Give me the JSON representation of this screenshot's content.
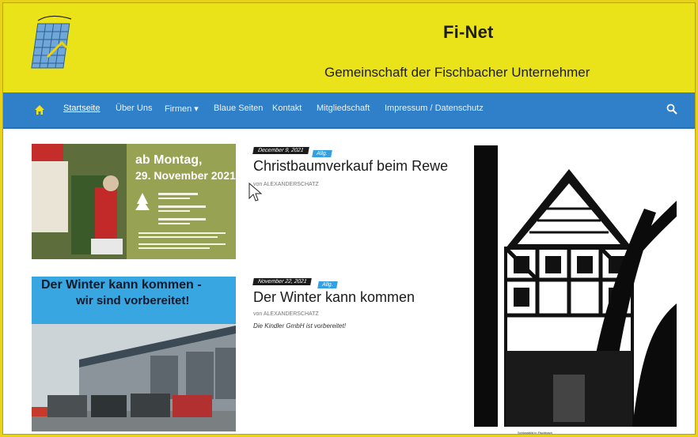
{
  "site": {
    "title": "Fi-Net",
    "tagline": "Gemeinschaft der Fischbacher Unternehmer"
  },
  "nav": {
    "items": [
      {
        "label": "Startseite",
        "active": true
      },
      {
        "label": "Über Uns"
      },
      {
        "label": "Firmen ▾"
      },
      {
        "label": "Blaue Seiten"
      },
      {
        "label": "Kontakt"
      },
      {
        "label": "Mitgliedschaft"
      },
      {
        "label": "Impressum / Datenschutz"
      }
    ],
    "home_icon": "home-icon",
    "search_icon": "search-icon"
  },
  "posts": [
    {
      "date": "December 9, 2021",
      "tag": "Allg.",
      "title": "Christbaumverkauf beim Rewe",
      "author_prefix": "von",
      "author": "ALEXANDERSCHATZ",
      "thumb_headline_1": "ab Montag,",
      "thumb_headline_2": "29. November 2021"
    },
    {
      "date": "November 22, 2021",
      "tag": "Allg.",
      "title": "Der Winter kann kommen",
      "author_prefix": "von",
      "author": "ALEXANDERSCHATZ",
      "excerpt": "Die Kindler GmbH ist vorbereitet!",
      "thumb_headline_1": "Der Winter kann kommen -",
      "thumb_headline_2": "wir sind vorbereitet!"
    }
  ],
  "sidebar": {
    "image_caption": "Schlossbild in Fischbach"
  },
  "colors": {
    "header_yellow": "#ebe31a",
    "nav_blue": "#2f80c9",
    "tag_blue": "#35a0e0"
  }
}
